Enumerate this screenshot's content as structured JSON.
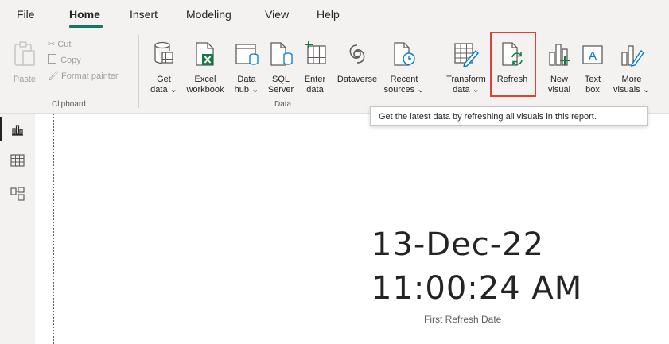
{
  "menu": {
    "items": [
      "File",
      "Home",
      "Insert",
      "Modeling",
      "View",
      "Help"
    ],
    "active": "Home"
  },
  "ribbon": {
    "clipboard": {
      "paste": "Paste",
      "cut": "Cut",
      "copy": "Copy",
      "format_painter": "Format painter",
      "group_label": "Clipboard"
    },
    "data": {
      "get_data": [
        "Get",
        "data ⌄"
      ],
      "excel": [
        "Excel",
        "workbook"
      ],
      "data_hub": [
        "Data",
        "hub ⌄"
      ],
      "sql": [
        "SQL",
        "Server"
      ],
      "enter_data": [
        "Enter",
        "data"
      ],
      "dataverse": [
        "Dataverse"
      ],
      "recent_sources": [
        "Recent",
        "sources ⌄"
      ],
      "group_label": "Data"
    },
    "queries": {
      "transform": [
        "Transform",
        "data ⌄"
      ],
      "refresh": [
        "Refresh"
      ]
    },
    "insert": {
      "new_visual": [
        "New",
        "visual"
      ],
      "text_box": [
        "Text",
        "box"
      ],
      "more_visuals": [
        "More",
        "visuals ⌄"
      ]
    }
  },
  "tooltip": "Get the latest data by refreshing all visuals in this report.",
  "card": {
    "date": "13-Dec-22",
    "time": "11:00:24 AM",
    "label": "First Refresh Date"
  },
  "colors": {
    "accent": "#117865",
    "highlight": "#e0403a",
    "excel_green": "#107c41"
  },
  "icons": [
    "report-view-icon",
    "table-view-icon",
    "model-view-icon"
  ]
}
